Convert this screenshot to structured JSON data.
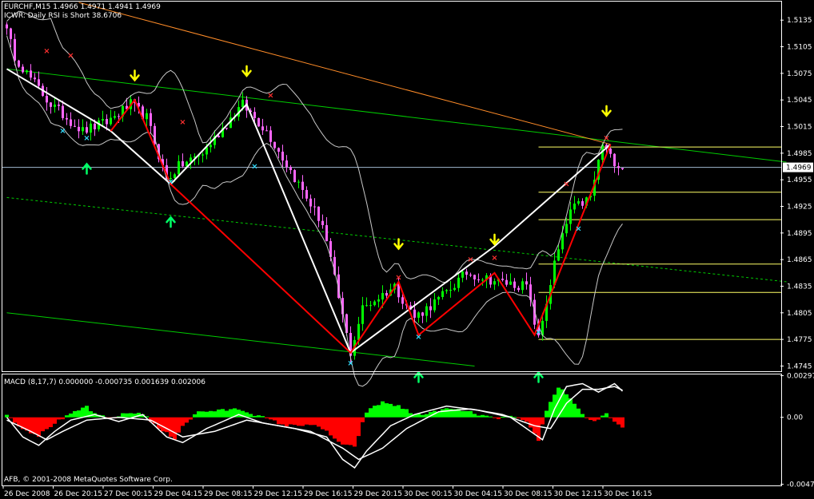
{
  "window": {
    "symbol_header": "EURCHF,M15  1.4966 1.4971 1.4941 1.4969",
    "indicator_header": "ICWR: Daily RSI is Short 38.6706",
    "macd_header": "MACD  (8,17,7) 0.000000 -0.000735 0.001639 0.002006",
    "copyright": "AFB, © 2001-2008 MetaQuotes Software Corp."
  },
  "colors": {
    "background": "#000000",
    "frame": "#ffffff",
    "bull_candle": "#00ff00",
    "bear_candle": "#ff66ff",
    "zigzag_white": "#ffffff",
    "zigzag_red": "#ff0000",
    "channel_green": "#00cc00",
    "trend_orange": "#ff8c28",
    "bands": "#c8c8c8",
    "fib_yellow": "#ffff66",
    "arrow_yellow": "#ffff00",
    "arrow_green": "#00ff66",
    "cross_red": "#ff3030",
    "cross_cyan": "#33ddff",
    "hist_pos": "#00ff00",
    "hist_neg": "#ff0000",
    "price_line": "#a0b8d0"
  },
  "chart_data": [
    {
      "type": "candlestick",
      "title": "EURCHF,M15",
      "x_labels": [
        "26 Dec 2008",
        "26 Dec 20:15",
        "27 Dec 00:15",
        "29 Dec 04:15",
        "29 Dec 08:15",
        "29 Dec 12:15",
        "29 Dec 16:15",
        "29 Dec 20:15",
        "30 Dec 00:15",
        "30 Dec 04:15",
        "30 Dec 08:15",
        "30 Dec 12:15",
        "30 Dec 16:15"
      ],
      "y_ticks": [
        "1.5135",
        "1.5105",
        "1.5075",
        "1.5045",
        "1.5015",
        "1.4985",
        "1.4955",
        "1.4925",
        "1.4895",
        "1.4865",
        "1.4835",
        "1.4805",
        "1.4775",
        "1.4745"
      ],
      "ylim": [
        1.474,
        1.5155
      ],
      "current_price": 1.4969,
      "current_price_label": "1.4969",
      "num_bars": 155,
      "close_keypoints": [
        [
          0,
          1.5135
        ],
        [
          3,
          1.5095
        ],
        [
          6,
          1.5075
        ],
        [
          12,
          1.504
        ],
        [
          20,
          1.501
        ],
        [
          26,
          1.502
        ],
        [
          32,
          1.504
        ],
        [
          36,
          1.5025
        ],
        [
          41,
          1.4955
        ],
        [
          44,
          1.497
        ],
        [
          50,
          1.4985
        ],
        [
          58,
          1.503
        ],
        [
          60,
          1.504
        ],
        [
          66,
          1.501
        ],
        [
          70,
          1.498
        ],
        [
          80,
          1.4905
        ],
        [
          86,
          1.478
        ],
        [
          87,
          1.476
        ],
        [
          90,
          1.481
        ],
        [
          98,
          1.4835
        ],
        [
          103,
          1.48
        ],
        [
          109,
          1.482
        ],
        [
          116,
          1.485
        ],
        [
          124,
          1.484
        ],
        [
          131,
          1.4835
        ],
        [
          134,
          1.4775
        ],
        [
          138,
          1.486
        ],
        [
          142,
          1.492
        ],
        [
          147,
          1.4935
        ],
        [
          150,
          1.4995
        ],
        [
          152,
          1.498
        ],
        [
          155,
          1.4969
        ]
      ],
      "zigzag_white": [
        [
          0,
          1.508
        ],
        [
          26,
          1.501
        ],
        [
          41,
          1.495
        ],
        [
          60,
          1.504
        ],
        [
          86,
          1.476
        ],
        [
          122,
          1.488
        ],
        [
          151,
          1.4995
        ]
      ],
      "zigzag_red": [
        [
          26,
          1.501
        ],
        [
          32,
          1.5045
        ],
        [
          41,
          1.495
        ],
        [
          86,
          1.476
        ],
        [
          98,
          1.484
        ],
        [
          103,
          1.478
        ],
        [
          122,
          1.485
        ],
        [
          132,
          1.478
        ],
        [
          151,
          1.4995
        ]
      ],
      "yellow_down_arrows": [
        [
          32,
          1.507
        ],
        [
          60,
          1.5075
        ],
        [
          98,
          1.488
        ],
        [
          122,
          1.4885
        ],
        [
          150,
          1.503
        ]
      ],
      "green_up_arrows": [
        [
          20,
          1.497
        ],
        [
          41,
          1.491
        ],
        [
          103,
          1.4735
        ],
        [
          133,
          1.4735
        ]
      ],
      "red_crosses": [
        [
          10,
          1.51
        ],
        [
          16,
          1.5095
        ],
        [
          44,
          1.502
        ],
        [
          66,
          1.505
        ],
        [
          98,
          1.4845
        ],
        [
          116,
          1.4865
        ],
        [
          122,
          1.4867
        ],
        [
          140,
          1.495
        ],
        [
          150,
          1.5002
        ]
      ],
      "cyan_crosses": [
        [
          14,
          1.501
        ],
        [
          20,
          1.5002
        ],
        [
          41,
          1.4953
        ],
        [
          62,
          1.497
        ],
        [
          86,
          1.4748
        ],
        [
          103,
          1.4778
        ],
        [
          133,
          1.4783
        ],
        [
          143,
          1.49
        ]
      ],
      "fib_levels": [
        1.4992,
        1.4941,
        1.491,
        1.486,
        1.4828,
        1.4775
      ],
      "fib_x_start": 133,
      "green_channel_top": [
        [
          0,
          1.508
        ],
        [
          195,
          1.4975
        ]
      ],
      "green_channel_dotted": [
        [
          0,
          1.4935
        ],
        [
          195,
          1.484
        ]
      ],
      "green_channel_bottom": [
        [
          0,
          1.4805
        ],
        [
          117,
          1.4745
        ]
      ],
      "orange_trend": [
        [
          18,
          1.5155
        ],
        [
          151,
          1.4995
        ]
      ]
    },
    {
      "type": "bar",
      "title": "MACD",
      "params": "(8,17,7)",
      "y_ticks": [
        "0.002970",
        "0.00",
        "-0.004770"
      ],
      "ylim": [
        -0.0048,
        0.003
      ],
      "histogram_keypoints": [
        [
          0,
          0.0002
        ],
        [
          4,
          -0.0008
        ],
        [
          8,
          -0.0013
        ],
        [
          12,
          -0.0004
        ],
        [
          16,
          0.0002
        ],
        [
          20,
          0.0008
        ],
        [
          22,
          0.0002
        ],
        [
          26,
          -0.0001
        ],
        [
          30,
          0.0003
        ],
        [
          34,
          0.0003
        ],
        [
          38,
          -0.0008
        ],
        [
          42,
          -0.0015
        ],
        [
          44,
          -0.0006
        ],
        [
          48,
          0.0004
        ],
        [
          54,
          0.0005
        ],
        [
          58,
          0.0006
        ],
        [
          62,
          0.0002
        ],
        [
          66,
          -0.0002
        ],
        [
          70,
          -0.0006
        ],
        [
          76,
          -0.0005
        ],
        [
          80,
          -0.001
        ],
        [
          84,
          -0.002
        ],
        [
          87,
          -0.0021
        ],
        [
          90,
          0.0004
        ],
        [
          94,
          0.0011
        ],
        [
          98,
          0.0008
        ],
        [
          102,
          0.0002
        ],
        [
          106,
          0.0003
        ],
        [
          110,
          0.0006
        ],
        [
          114,
          0.0005
        ],
        [
          118,
          0.0002
        ],
        [
          122,
          -0.0001
        ],
        [
          126,
          0.0001
        ],
        [
          130,
          -0.0004
        ],
        [
          133,
          -0.0016
        ],
        [
          135,
          0.0005
        ],
        [
          138,
          0.0022
        ],
        [
          141,
          0.0014
        ],
        [
          144,
          0.0002
        ],
        [
          147,
          -0.0003
        ],
        [
          150,
          0.0002
        ],
        [
          153,
          -0.0006
        ],
        [
          155,
          -0.0008
        ]
      ],
      "main_line_keypoints": [
        [
          0,
          0.0
        ],
        [
          4,
          -0.0014
        ],
        [
          8,
          -0.002
        ],
        [
          12,
          -0.001
        ],
        [
          16,
          -0.0002
        ],
        [
          22,
          0.0002
        ],
        [
          28,
          -0.0003
        ],
        [
          34,
          0.0002
        ],
        [
          40,
          -0.0014
        ],
        [
          44,
          -0.0018
        ],
        [
          50,
          -0.0008
        ],
        [
          58,
          0.0002
        ],
        [
          64,
          -0.0004
        ],
        [
          72,
          -0.0008
        ],
        [
          80,
          -0.0014
        ],
        [
          84,
          -0.003
        ],
        [
          87,
          -0.0036
        ],
        [
          90,
          -0.0024
        ],
        [
          96,
          -0.0006
        ],
        [
          102,
          0.0002
        ],
        [
          110,
          0.0008
        ],
        [
          118,
          0.0005
        ],
        [
          126,
          0.0
        ],
        [
          131,
          -0.001
        ],
        [
          134,
          -0.0016
        ],
        [
          137,
          0.0006
        ],
        [
          140,
          0.0022
        ],
        [
          144,
          0.0024
        ],
        [
          148,
          0.0018
        ],
        [
          152,
          0.0024
        ],
        [
          155,
          0.0016
        ]
      ],
      "signal_line_keypoints": [
        [
          0,
          -0.0002
        ],
        [
          6,
          -0.001
        ],
        [
          10,
          -0.0016
        ],
        [
          14,
          -0.001
        ],
        [
          20,
          -0.0002
        ],
        [
          28,
          0.0
        ],
        [
          36,
          -0.0002
        ],
        [
          44,
          -0.0014
        ],
        [
          52,
          -0.001
        ],
        [
          60,
          -0.0002
        ],
        [
          68,
          -0.0006
        ],
        [
          76,
          -0.001
        ],
        [
          84,
          -0.0022
        ],
        [
          88,
          -0.003
        ],
        [
          94,
          -0.0022
        ],
        [
          100,
          -0.0008
        ],
        [
          108,
          0.0004
        ],
        [
          116,
          0.0006
        ],
        [
          124,
          0.0002
        ],
        [
          132,
          -0.0006
        ],
        [
          136,
          -0.0008
        ],
        [
          140,
          0.001
        ],
        [
          144,
          0.002
        ],
        [
          148,
          0.002
        ],
        [
          152,
          0.0022
        ],
        [
          155,
          0.0018
        ]
      ]
    }
  ]
}
